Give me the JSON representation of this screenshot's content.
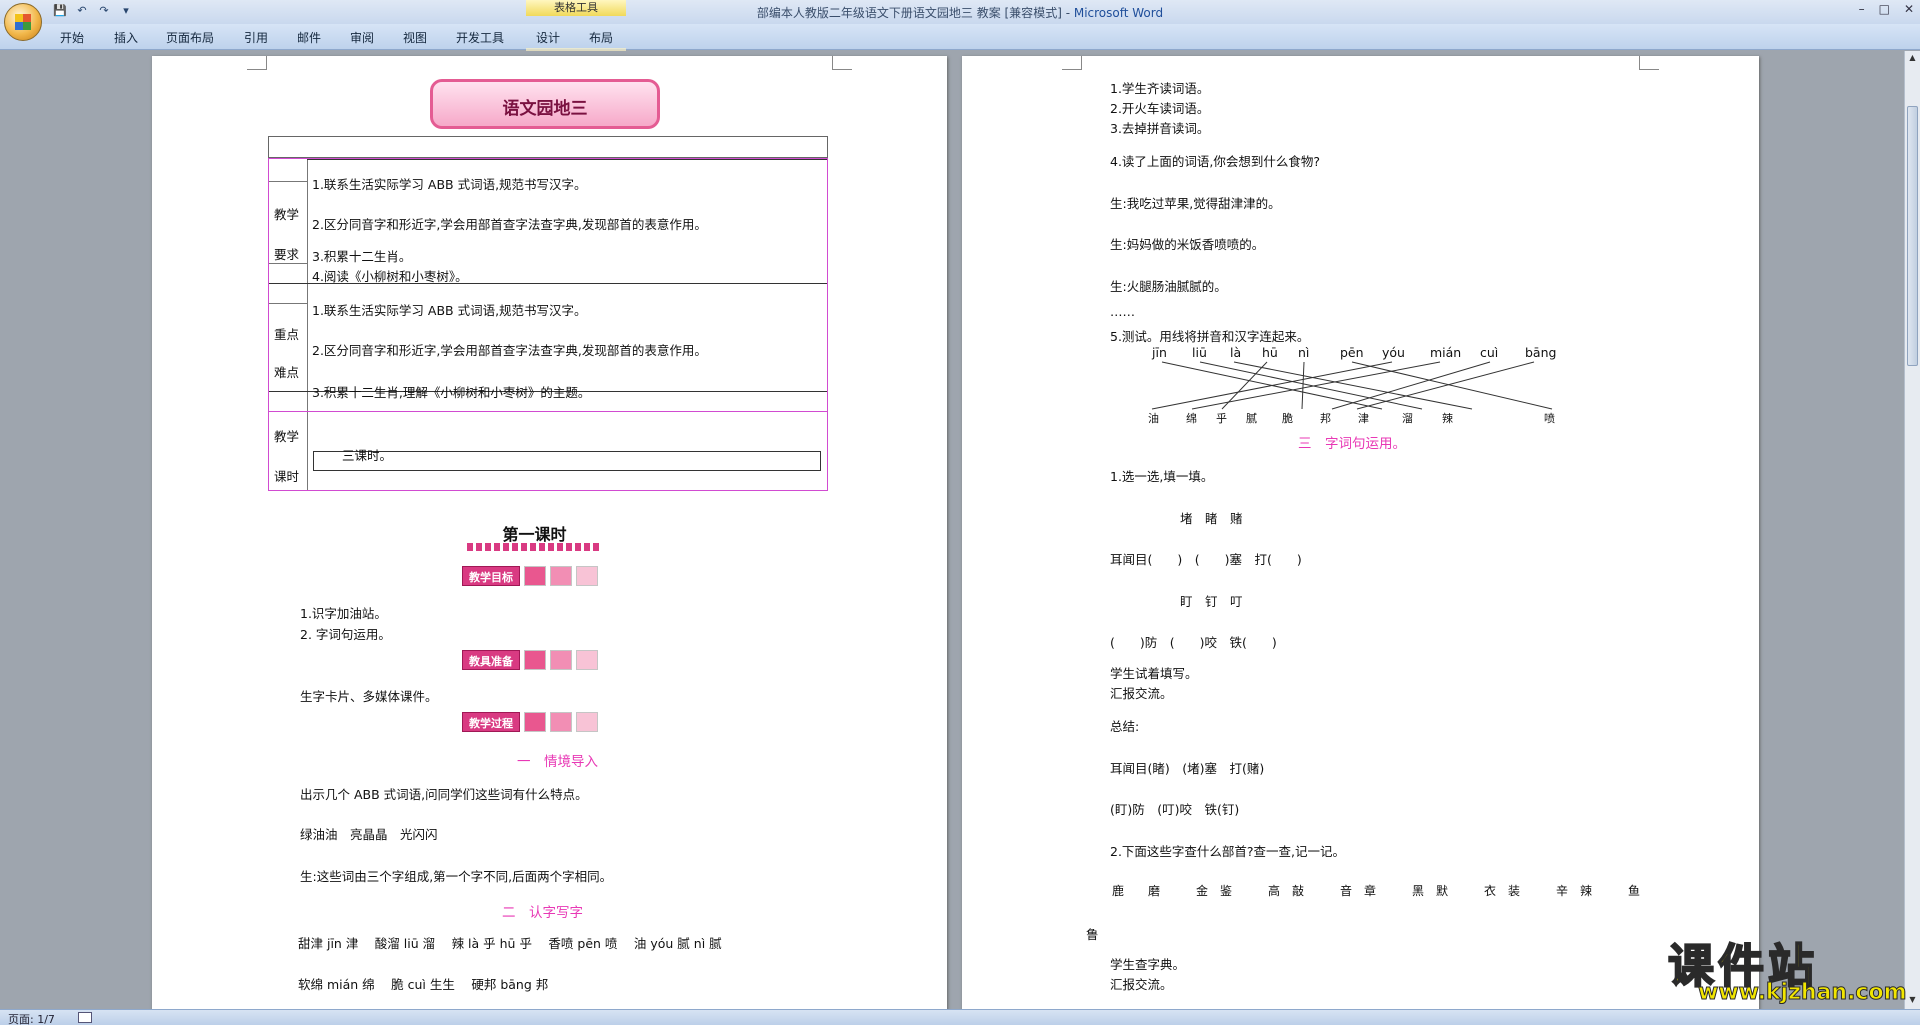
{
  "window": {
    "title": "部编本人教版二年级语文下册语文园地三 教案 [兼容模式]",
    "separator": " - ",
    "app": "Microsoft Word",
    "context_group": "表格工具",
    "controls": [
      "–",
      "□",
      "✕"
    ]
  },
  "qat": [
    "💾",
    "↶",
    "↷",
    "▾"
  ],
  "tabs": [
    "开始",
    "插入",
    "页面布局",
    "引用",
    "邮件",
    "审阅",
    "视图",
    "开发工具",
    "设计",
    "布局"
  ],
  "help": "?",
  "status": {
    "page": "页面: 1/7"
  },
  "page1": {
    "banner": "语文园地三",
    "table": {
      "label1a": "教学",
      "label1b": "要求",
      "goals": [
        "1.联系生活实际学习 ABB 式词语,规范书写汉字。",
        "2.区分同音字和形近字,学会用部首查字法查字典,发现部首的表意作用。",
        "3.积累十二生肖。",
        "4.阅读《小柳树和小枣树》。"
      ],
      "label2a": "重点",
      "label2b": "难点",
      "key": [
        "1.联系生活实际学习 ABB 式词语,规范书写汉字。",
        "2.区分同音字和形近字,学会用部首查字法查字典,发现部首的表意作用。",
        "3.积累十二生肖,理解《小柳树和小枣树》的主题。"
      ],
      "label3a": "教学",
      "label3b": "课时",
      "hours": "三课时。"
    },
    "lesson_title": "第一课时",
    "pill_objectives": "教学目标",
    "objectives": [
      "1.识字加油站。",
      "2. 字词句运用。"
    ],
    "pill_prep": "教具准备",
    "prep": "生字卡片、多媒体课件。",
    "pill_process": "教学过程",
    "sec1": "一　情境导入",
    "intro": "出示几个 ABB 式词语,问同学们这些词有什么特点。",
    "abb": "绿油油　亮晶晶　光闪闪",
    "student": "生:这些词由三个字组成,第一个字不同,后面两个字相同。",
    "sec2": "二　认字写字",
    "pinyin1": "甜津 jīn 津　 酸溜 liū 溜　 辣 là 乎 hū 乎　 香喷 pēn 喷　 油 yóu 腻 nì 腻",
    "pinyin2": "软绵 mián 绵　 脆 cuì 生生　 硬邦 bāng 邦"
  },
  "page2": {
    "l1": "1.学生齐读词语。",
    "l2": "2.开火车读词语。",
    "l3": "3.去掉拼音读词。",
    "l4": "4.读了上面的词语,你会想到什么食物?",
    "l5": "生:我吃过苹果,觉得甜津津的。",
    "l6": "生:妈妈做的米饭香喷喷的。",
    "l7": "生:火腿肠油腻腻的。",
    "l8": "……",
    "l9": "5.测试。用线将拼音和汉字连起来。",
    "pinyin_row": [
      "jīn",
      "liū",
      "là",
      "hū",
      "nì",
      "pēn",
      "yóu",
      "mián",
      "cuì",
      "bāng"
    ],
    "hanzi_row": [
      "油",
      "绵",
      "乎",
      "腻",
      "脆",
      "邦",
      "津",
      "溜",
      "辣",
      "喷"
    ],
    "sec3": "三　字词句运用。",
    "m1": "1.选一选,填一填。",
    "m2": "堵　睹　赌",
    "m3": "耳闻目(　　)　(　　)塞　打(　　)",
    "m4": "盯　钉　叮",
    "m5": "(　　)防　(　　)咬　铁(　　)",
    "m6": "学生试着填写。",
    "m7": "汇报交流。",
    "m8": "总结:",
    "m9": "耳闻目(睹)　(堵)塞　打(赌)",
    "m10": "(盯)防　(叮)咬　铁(钉)",
    "m11": "2.下面这些字查什么部首?查一查,记一记。",
    "m12": "鹿　　磨　　　金　鉴　　　高　敲　　　音　章　　　黑　默　　　衣　装　　　辛　辣　　　鱼",
    "m13": "鲁",
    "m14": "学生查字典。",
    "m15": "汇报交流。"
  },
  "watermark": {
    "big": "课件站",
    "url": "www.kjzhan.com"
  }
}
